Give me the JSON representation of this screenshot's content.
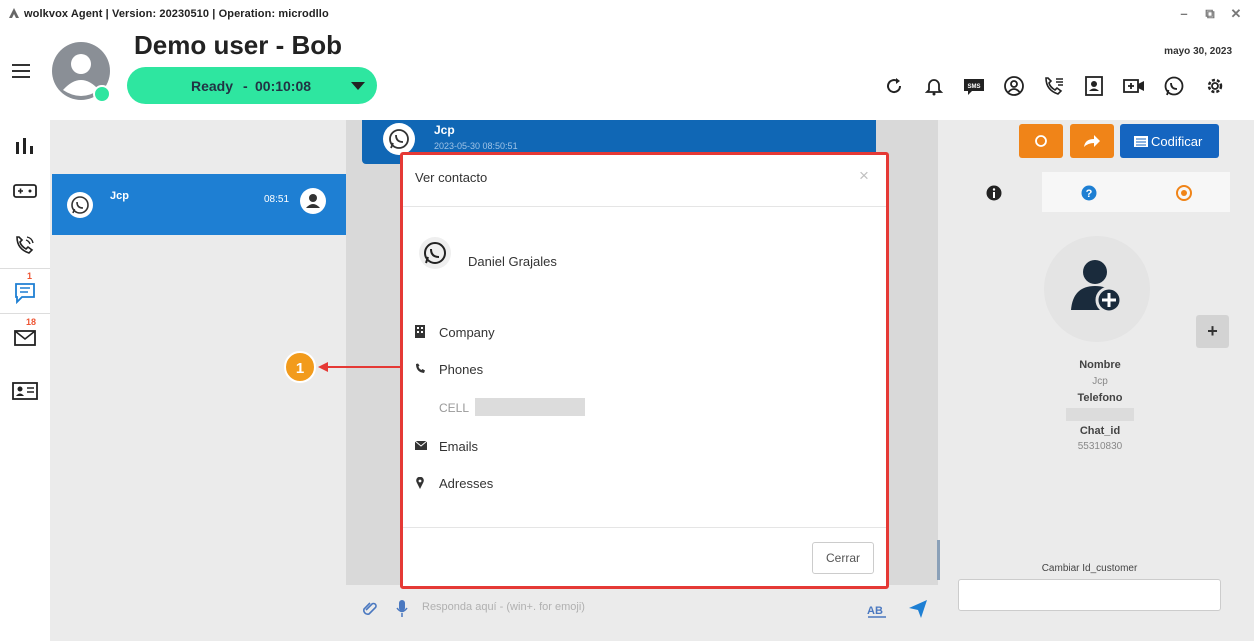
{
  "window": {
    "title": "wolkvox Agent | Version: 20230510  | Operation: microdllo"
  },
  "header": {
    "user_name": "Demo user - Bob",
    "status_label": "Ready",
    "status_separator": "-",
    "status_timer": "00:10:08",
    "date": "mayo 30, 2023",
    "toolbar_icons": [
      "refresh-icon",
      "bell-icon",
      "sms-icon",
      "user-circle-icon",
      "phone-list-icon",
      "contact-card-icon",
      "video-plus-icon",
      "whatsapp-icon",
      "gear-icon"
    ]
  },
  "nav": {
    "chat_badge": "1",
    "mail_badge": "18"
  },
  "chatlist": {
    "item": {
      "name": "Jcp",
      "time": "08:51"
    }
  },
  "chat": {
    "top_name": "Jcp",
    "top_sub": "2023-05-30 08:50:51",
    "input_placeholder": "Responda aquí - (win+. for emoji)"
  },
  "actions": {
    "codificar_label": "Codificar"
  },
  "modal": {
    "title": "Ver contacto",
    "close_x": "×",
    "contact_name": "Daniel Grajales",
    "company_label": "Company",
    "phones_label": "Phones",
    "cell_label": "CELL",
    "emails_label": "Emails",
    "addresses_label": "Adresses",
    "cerrar_label": "Cerrar"
  },
  "callout": {
    "number": "1"
  },
  "right_panel": {
    "nombre_label": "Nombre",
    "nombre_value": "Jcp",
    "telefono_label": "Telefono",
    "chat_id_label": "Chat_id",
    "chat_id_value": "55310830",
    "plus_label": "+",
    "cambiar_label": "Cambiar Id_customer"
  },
  "colors": {
    "status_green": "#2ee6a0",
    "accent_blue": "#1e7fd3",
    "orange": "#f08418",
    "modal_border": "#e53935"
  }
}
